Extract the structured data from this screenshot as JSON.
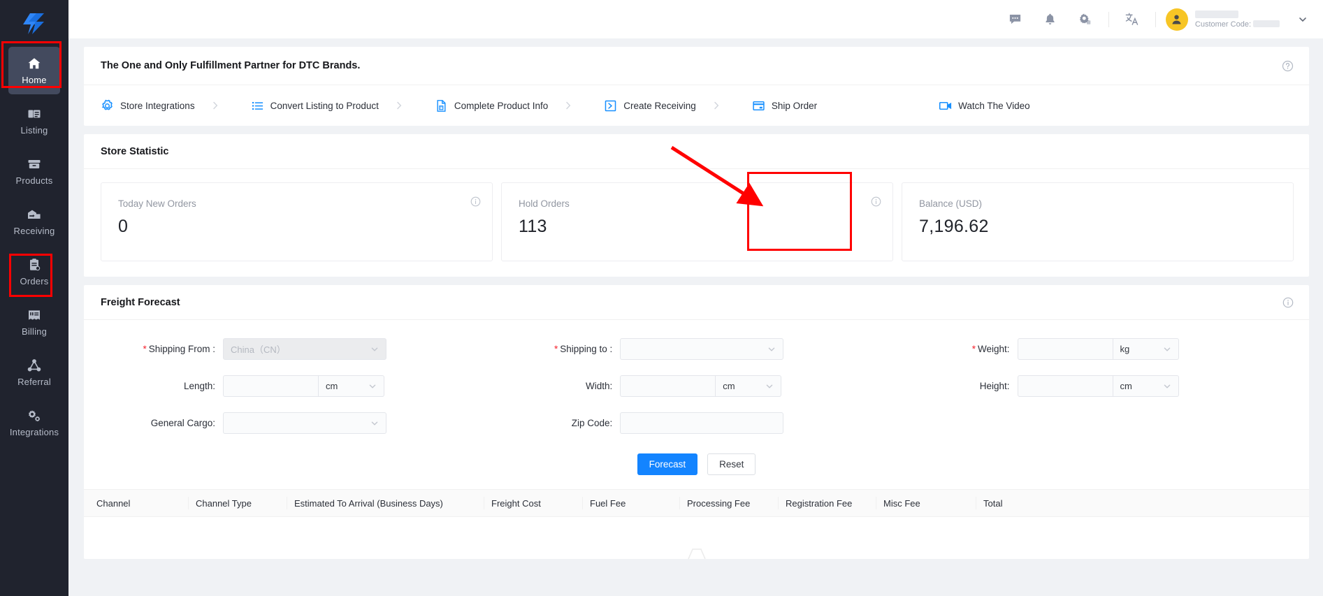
{
  "sidebar": {
    "logo_name": "lightning-bolt-logo",
    "items": [
      {
        "id": "home",
        "label": "Home",
        "icon": "home-icon",
        "active": true,
        "highlighted": true
      },
      {
        "id": "listing",
        "label": "Listing",
        "icon": "listing-icon",
        "active": false,
        "highlighted": false
      },
      {
        "id": "products",
        "label": "Products",
        "icon": "products-icon",
        "active": false,
        "highlighted": false
      },
      {
        "id": "receiving",
        "label": "Receiving",
        "icon": "receiving-icon",
        "active": false,
        "highlighted": false
      },
      {
        "id": "orders",
        "label": "Orders",
        "icon": "orders-icon",
        "active": false,
        "highlighted": false
      },
      {
        "id": "billing",
        "label": "Billing",
        "icon": "billing-icon",
        "active": false,
        "highlighted": true
      },
      {
        "id": "referral",
        "label": "Referral",
        "icon": "referral-icon",
        "active": false,
        "highlighted": false
      },
      {
        "id": "integrations",
        "label": "Integrations",
        "icon": "integrations-icon",
        "active": false,
        "highlighted": false
      }
    ]
  },
  "topbar": {
    "icons": [
      "chat-icon",
      "bell-icon",
      "settings-icon",
      "translate-icon"
    ],
    "user": {
      "avatar_icon": "user-avatar-icon",
      "name_redacted": true,
      "customer_code_label": "Customer Code:",
      "customer_code_redacted": true,
      "caret_icon": "chevron-down-icon"
    }
  },
  "banner": {
    "title": "The One and Only Fulfillment Partner for DTC Brands.",
    "help_icon": "help-circle-icon",
    "steps": [
      {
        "label": "Store Integrations",
        "icon": "gear-outline-icon"
      },
      {
        "label": "Convert Listing to Product",
        "icon": "list-icon"
      },
      {
        "label": "Complete Product Info",
        "icon": "product-doc-icon"
      },
      {
        "label": "Create Receiving",
        "icon": "arrow-box-icon"
      },
      {
        "label": "Ship Order",
        "icon": "shipping-card-icon"
      },
      {
        "label": "Watch The Video",
        "icon": "video-camera-icon"
      }
    ],
    "separator_icon": "chevron-right-icon"
  },
  "store_statistic": {
    "title": "Store Statistic",
    "cards": [
      {
        "label": "Today New Orders",
        "value": "0",
        "info_icon": "info-circle-icon",
        "highlighted": false
      },
      {
        "label": "Hold Orders",
        "value": "113",
        "info_icon": "info-circle-icon",
        "highlighted": false
      },
      {
        "label": "Balance (USD)",
        "value": "7,196.62",
        "info_icon": "",
        "highlighted": true
      }
    ]
  },
  "freight_forecast": {
    "title": "Freight Forecast",
    "info_icon": "info-circle-icon",
    "fields": {
      "shipping_from": {
        "label": "Shipping From :",
        "required": true,
        "value": "China（CN）",
        "disabled": true,
        "control": "select"
      },
      "shipping_to": {
        "label": "Shipping to :",
        "required": true,
        "value": "",
        "disabled": false,
        "control": "select"
      },
      "weight": {
        "label": "Weight:",
        "required": true,
        "value": "",
        "unit": "kg",
        "control": "input-unit"
      },
      "length": {
        "label": "Length:",
        "required": false,
        "value": "",
        "unit": "cm",
        "control": "input-unit"
      },
      "width": {
        "label": "Width:",
        "required": false,
        "value": "",
        "unit": "cm",
        "control": "input-unit"
      },
      "height": {
        "label": "Height:",
        "required": false,
        "value": "",
        "unit": "cm",
        "control": "input-unit"
      },
      "general_cargo": {
        "label": "General Cargo:",
        "required": false,
        "value": "",
        "disabled": false,
        "control": "select"
      },
      "zip_code": {
        "label": "Zip Code:",
        "required": false,
        "value": "",
        "control": "input"
      }
    },
    "buttons": {
      "forecast": "Forecast",
      "reset": "Reset"
    },
    "table": {
      "columns": [
        "Channel",
        "Channel Type",
        "Estimated To Arrival (Business Days)",
        "Freight Cost",
        "Fuel Fee",
        "Processing Fee",
        "Registration Fee",
        "Misc Fee",
        "Total"
      ],
      "rows": []
    }
  },
  "annotations": {
    "arrow": {
      "name": "red-arrow-annotation",
      "color": "#ff0000"
    },
    "boxes": [
      {
        "name": "home-nav-highlight",
        "color": "#ff0000"
      },
      {
        "name": "billing-nav-highlight",
        "color": "#ff0000"
      },
      {
        "name": "balance-card-highlight",
        "color": "#ff0000"
      }
    ]
  },
  "colors": {
    "sidebar_bg": "#20232e",
    "sidebar_active": "#434a5e",
    "primary": "#1384ff",
    "step_icon": "#1890ff",
    "annotation": "#ff0000",
    "avatar": "#f7c525",
    "page_bg": "#f0f2f5"
  }
}
